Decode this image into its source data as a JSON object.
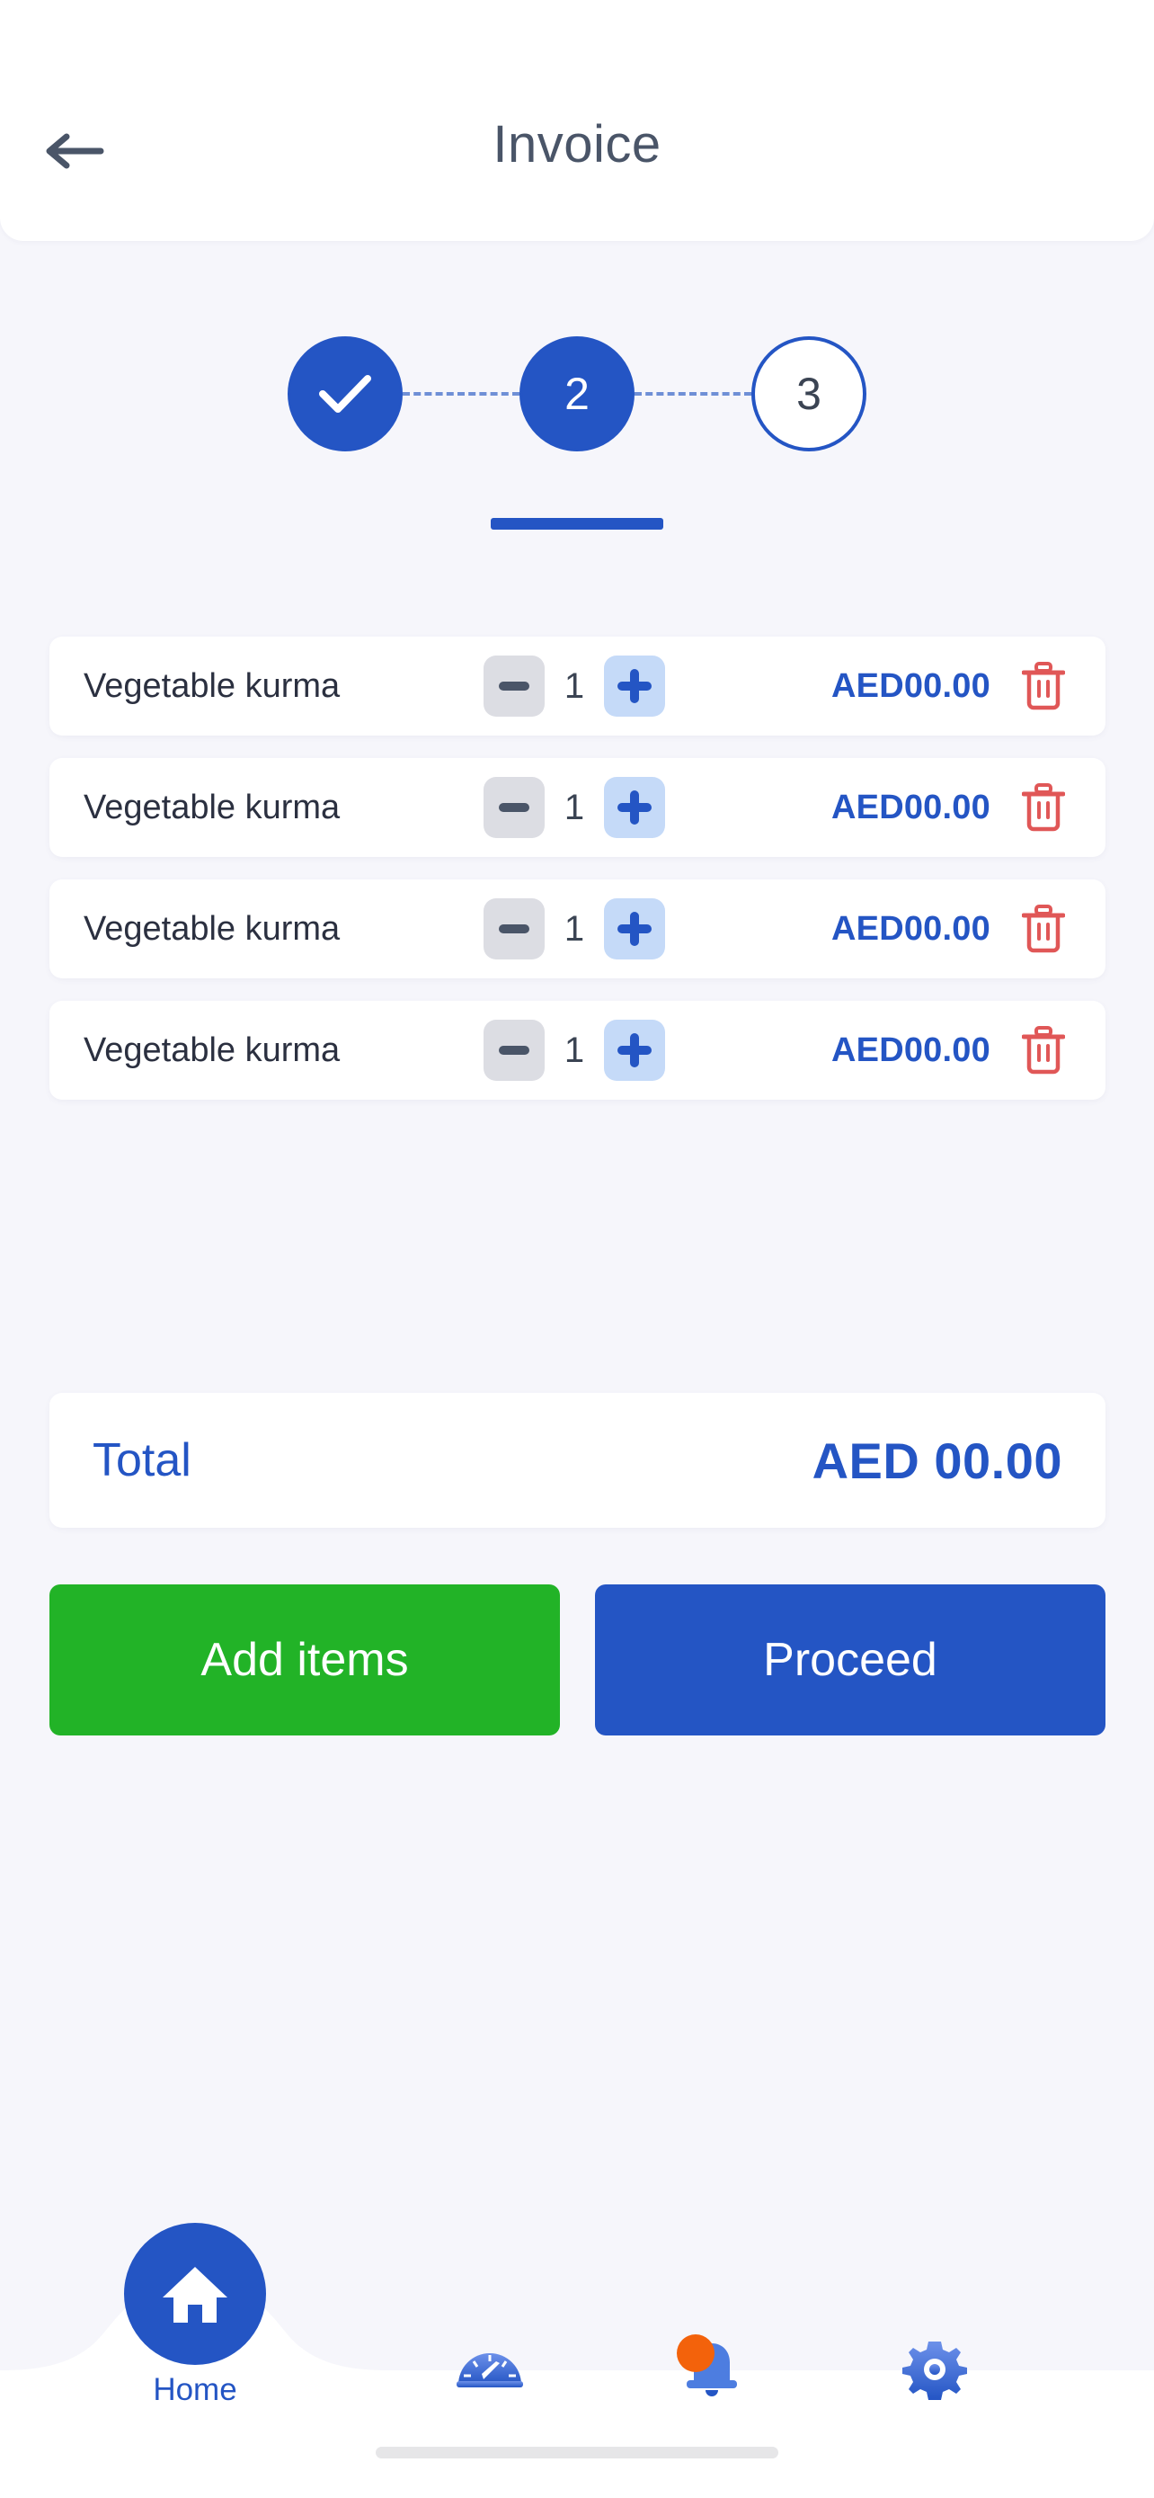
{
  "header": {
    "title": "Invoice",
    "back_icon": "arrow-left-icon"
  },
  "stepper": {
    "steps": [
      {
        "label": "✓",
        "state": "done"
      },
      {
        "label": "2",
        "state": "active"
      },
      {
        "label": "3",
        "state": "todo"
      }
    ],
    "accent_color": "#2455c4",
    "line_color": "#6f8fd6"
  },
  "items": [
    {
      "name": "Vegetable kurma",
      "qty": "1",
      "price": "AED00.00",
      "minus_label": "−",
      "plus_label": "+",
      "delete_icon": "trash-icon"
    },
    {
      "name": "Vegetable kurma",
      "qty": "1",
      "price": "AED00.00",
      "minus_label": "−",
      "plus_label": "+",
      "delete_icon": "trash-icon"
    },
    {
      "name": "Vegetable kurma",
      "qty": "1",
      "price": "AED00.00",
      "minus_label": "−",
      "plus_label": "+",
      "delete_icon": "trash-icon"
    },
    {
      "name": "Vegetable kurma",
      "qty": "1",
      "price": "AED00.00",
      "minus_label": "−",
      "plus_label": "+",
      "delete_icon": "trash-icon"
    }
  ],
  "total": {
    "label": "Total",
    "value": "AED 00.00"
  },
  "actions": {
    "add_label": "Add items",
    "add_color": "#22b327",
    "proceed_label": "Proceed",
    "proceed_color": "#2455c4"
  },
  "bottom_nav": {
    "home": {
      "label": "Home",
      "icon": "home-icon",
      "active": true
    },
    "gauge": {
      "icon": "speedometer-icon"
    },
    "notifications": {
      "icon": "bell-icon",
      "badge": true,
      "badge_color": "#f3620b"
    },
    "settings": {
      "icon": "gear-icon"
    }
  },
  "colors": {
    "background": "#f6f6fb",
    "card": "#ffffff",
    "primary": "#2455c4",
    "minus_bg": "#dcdde3",
    "plus_bg": "#c5daf8",
    "danger": "#e05757"
  }
}
